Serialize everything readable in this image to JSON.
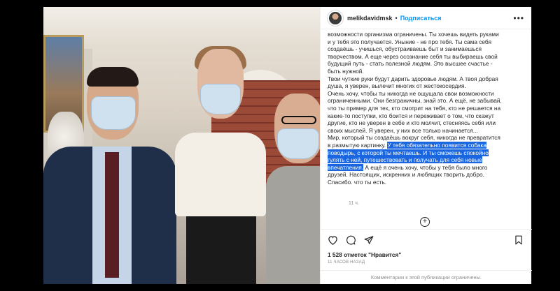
{
  "post": {
    "username": "melikdavidmsk",
    "separator": "•",
    "follow_label": "Подписаться",
    "more_icon": "more-horizontal-icon",
    "caption_lines": [
      "возможности организма ограничены. Ты хочешь видеть руками",
      "и у тебя это получается. Уныние - не про тебя. Ты сама себя",
      "создаёшь - учишься, обустраиваешь быт и занимаешься",
      "творчеством. А еще через осознание себя ты выбираешь свой",
      "будущий путь - стать полезной людям. Это высшее счастье -",
      "быть нужной.",
      "Твои чуткие руки будут дарить здоровье людям. А твоя добрая",
      "душа, я уверен, вылечит многих от жестокосердия.",
      "Очень хочу, чтобы ты никогда не ощущала свои возможности",
      "ограниченными. Они безграничны, знай это. А ещё, не забывай,",
      "что ты пример для тех, кто смотрит на тебя, кто не решается на",
      "какие-то поступки, кто боится и переживает о том, что скажут",
      "другие, кто не уверен в себе и кто молчит, стесняясь себя или",
      "своих мыслей. Я уверен, у них все только начинается...",
      "Мир, который ты создаёшь вокруг себя, никогда не превратится"
    ],
    "caption_mixed": {
      "l16_plain": "в размытую картинку. ",
      "l16_hl": "У тебя обязательно появится собака",
      "l17_hl": "поводырь, с которой ты мечтаешь. И ты сможешь спокойно",
      "l18_hl": "гулять с ней, путешествовать и получать для себя новые",
      "l19_hl": "впечатления.",
      "l19_plain": " А ещё я очень хочу, чтобы у тебя было много",
      "l20": "друзей. Настоящих, искренних и любящих творить добро.",
      "l21": "Спасибо, что ты есть."
    },
    "caption_time": "11 ч.",
    "load_more_icon": "plus-circle-icon",
    "likes_text": "1 528 отметок \"Нравится\"",
    "post_time": "11 ЧАСОВ НАЗАД",
    "comments_limited": "Комментарии к этой публикации ограничены."
  },
  "icons": {
    "like": "heart-icon",
    "comment": "comment-icon",
    "share": "paper-plane-icon",
    "save": "bookmark-icon"
  }
}
